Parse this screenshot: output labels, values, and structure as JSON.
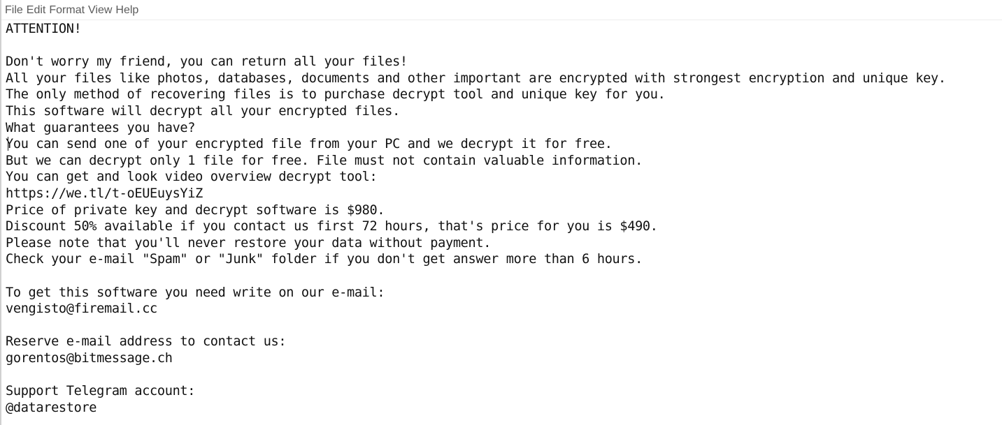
{
  "menubar": {
    "items": [
      {
        "label": "File"
      },
      {
        "label": "Edit"
      },
      {
        "label": "Format"
      },
      {
        "label": "View"
      },
      {
        "label": "Help"
      }
    ]
  },
  "document": {
    "lines": [
      "ATTENTION!",
      "",
      "Don't worry my friend, you can return all your files!",
      "All your files like photos, databases, documents and other important are encrypted with strongest encryption and unique key.",
      "The only method of recovering files is to purchase decrypt tool and unique key for you.",
      "This software will decrypt all your encrypted files.",
      "What guarantees you have?",
      "You can send one of your encrypted file from your PC and we decrypt it for free.",
      "But we can decrypt only 1 file for free. File must not contain valuable information.",
      "You can get and look video overview decrypt tool:",
      "https://we.tl/t-oEUEuysYiZ",
      "Price of private key and decrypt software is $980.",
      "Discount 50% available if you contact us first 72 hours, that's price for you is $490.",
      "Please note that you'll never restore your data without payment.",
      "Check your e-mail \"Spam\" or \"Junk\" folder if you don't get answer more than 6 hours.",
      "",
      "To get this software you need write on our e-mail:",
      "vengisto@firemail.cc",
      "",
      "Reserve e-mail address to contact us:",
      "gorentos@bitmessage.ch",
      "",
      "Support Telegram account:",
      "@datarestore"
    ]
  }
}
